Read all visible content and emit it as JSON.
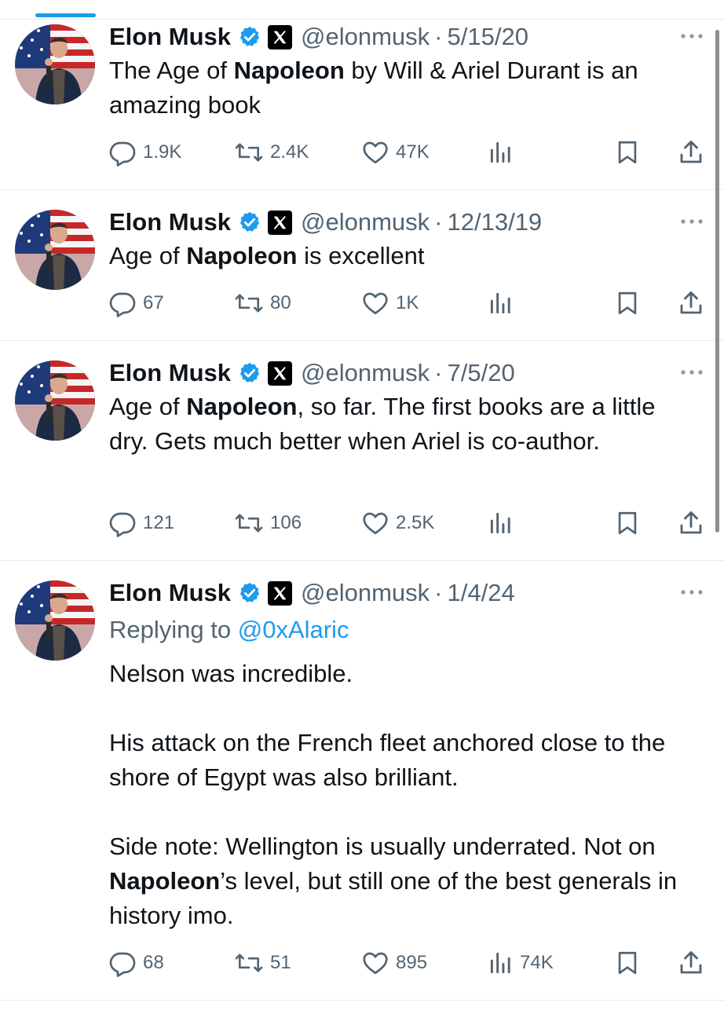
{
  "author": {
    "name": "Elon Musk",
    "handle": "@elonmusk"
  },
  "tweets": [
    {
      "date": "5/15/20",
      "text_parts": [
        "The Age of ",
        "Napoleon",
        " by Will & Ariel Durant is an amazing book"
      ],
      "replies": "1.9K",
      "reposts": "2.4K",
      "likes": "47K",
      "views": ""
    },
    {
      "date": "12/13/19",
      "text_parts": [
        "Age of ",
        "Napoleon",
        " is excellent"
      ],
      "replies": "67",
      "reposts": "80",
      "likes": "1K",
      "views": ""
    },
    {
      "date": "7/5/20",
      "text_parts": [
        "Age of ",
        "Napoleon",
        ", so far. The first books are a little dry. Gets much better when Ariel is co-author."
      ],
      "replies": "121",
      "reposts": "106",
      "likes": "2.5K",
      "views": ""
    },
    {
      "date": "1/4/24",
      "replying_prefix": "Replying to ",
      "replying_to": "@0xAlaric",
      "text_parts": [
        "Nelson was incredible.\n\nHis attack on the French fleet anchored close to the shore of Egypt was also brilliant.\n\nSide note: Wellington is usually underrated. Not on ",
        "Napoleon",
        "’s level, but still one of the best generals in history imo."
      ],
      "replies": "68",
      "reposts": "51",
      "likes": "895",
      "views": "74K"
    }
  ],
  "separator_dot": "·",
  "colors": {
    "accent": "#1d9bf0",
    "secondary_text": "#536471",
    "primary_text": "#0f1419",
    "divider": "#e6ecf0"
  },
  "icons": [
    "verified-badge-icon",
    "x-logo-icon",
    "more-icon",
    "reply-icon",
    "repost-icon",
    "like-icon",
    "views-icon",
    "bookmark-icon",
    "share-icon"
  ]
}
